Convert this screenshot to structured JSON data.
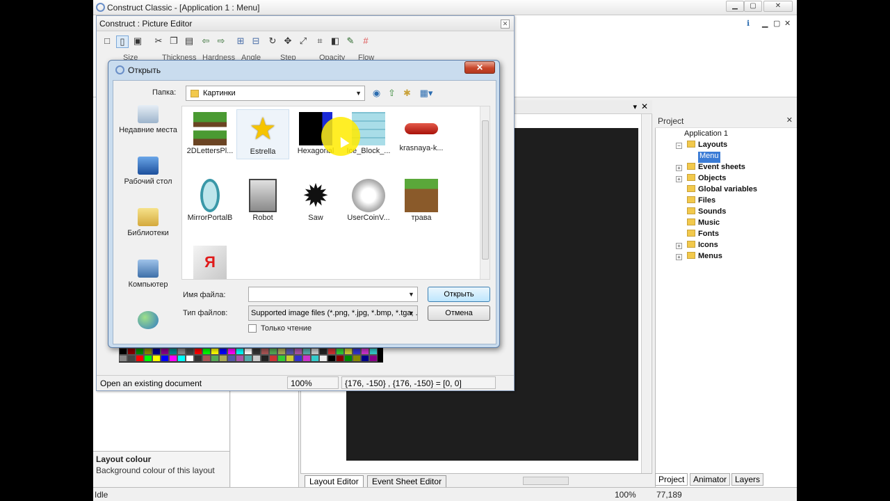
{
  "app": {
    "title": "Construct Classic - [Application 1 : Menu]",
    "window_buttons": [
      "▁",
      "▢",
      "✕"
    ],
    "ribbon_controls": [
      "ℹ",
      "▁",
      "▢",
      "✕"
    ]
  },
  "picture_editor": {
    "title": "Construct : Picture Editor",
    "tool_labels": [
      "Size",
      "Thickness",
      "Hardness",
      "Angle",
      "Step",
      "Opacity",
      "Flow"
    ],
    "status_message": "Open an existing document",
    "zoom": "100%",
    "coords": "{176, -150} , {176, -150} = [0, 0]"
  },
  "open_dialog": {
    "title": "Открыть",
    "folder_label": "Папка:",
    "folder_value": "Картинки",
    "places": [
      "Недавние места",
      "Рабочий стол",
      "Библиотеки",
      "Компьютер",
      ""
    ],
    "files": [
      {
        "name": "2DLettersPl...",
        "icon": "grass-block-icon"
      },
      {
        "name": "Estrella",
        "icon": "star-icon"
      },
      {
        "name": "Hexagonal",
        "icon": "hexagon-icon"
      },
      {
        "name": "Ice_Block_...",
        "icon": "ice-block-icon"
      },
      {
        "name": "krasnaya-k...",
        "icon": "red-button-icon"
      },
      {
        "name": "MirrorPortalB",
        "icon": "portal-icon"
      },
      {
        "name": "Robot",
        "icon": "robot-icon"
      },
      {
        "name": "Saw",
        "icon": "saw-icon"
      },
      {
        "name": "UserCoinV...",
        "icon": "coin-icon"
      },
      {
        "name": "трава",
        "icon": "grass-icon"
      },
      {
        "name": "",
        "icon": "yandex-icon"
      }
    ],
    "filename_label": "Имя файла:",
    "filename_value": "",
    "filetype_label": "Тип файлов:",
    "filetype_value": "Supported image files (*.png, *.jpg, *.bmp, *.tga, ...",
    "readonly_label": "Только чтение",
    "open_button": "Открыть",
    "cancel_button": "Отмена"
  },
  "properties_help": {
    "heading": "Layout colour",
    "description": "Background colour of this layout"
  },
  "editor_tabs": [
    "Layout Editor",
    "Event Sheet Editor"
  ],
  "project": {
    "title": "Project",
    "root": "Application 1",
    "items": [
      "Layouts",
      "Menu",
      "Event sheets",
      "Objects",
      "Global variables",
      "Files",
      "Sounds",
      "Music",
      "Fonts",
      "Icons",
      "Menus"
    ],
    "tabs": [
      "Project",
      "Animator",
      "Layers"
    ]
  },
  "statusbar": {
    "state": "Idle",
    "zoom": "100%",
    "mouse": "77,189"
  }
}
